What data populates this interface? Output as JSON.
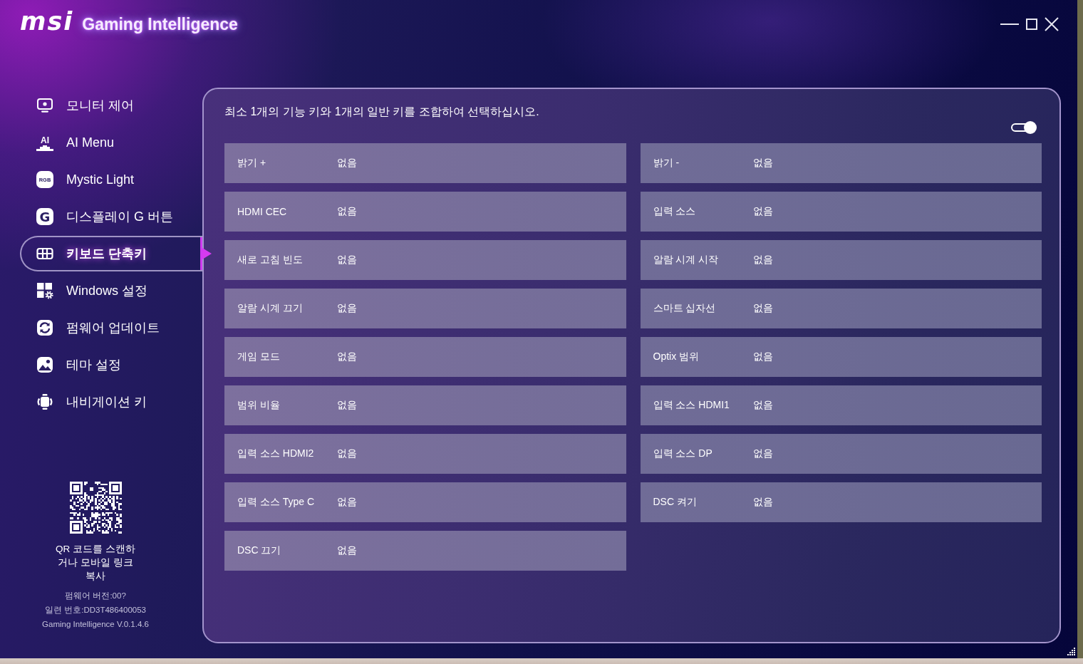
{
  "window": {
    "logo": "msi",
    "title": "Gaming Intelligence"
  },
  "sidebar": {
    "items": [
      {
        "label": "모니터 제어",
        "selected": false
      },
      {
        "label": "AI Menu",
        "icon_text": "AI",
        "selected": false
      },
      {
        "label": "Mystic Light",
        "icon_text": "RGB",
        "selected": false
      },
      {
        "label": "디스플레이 G 버튼",
        "icon_text": "G",
        "selected": false
      },
      {
        "label": "키보드 단축키",
        "selected": true
      },
      {
        "label": "Windows 설정",
        "selected": false
      },
      {
        "label": "펌웨어 업데이트",
        "selected": false
      },
      {
        "label": "테마 설정",
        "selected": false
      },
      {
        "label": "내비게이션 키",
        "selected": false
      }
    ],
    "qr_caption": "QR 코드를 스캔하거나 모바일 링크 복사",
    "firmware_version": "펌웨어 버전:00?",
    "serial_number": "일련 번호:DD3T486400053",
    "app_version": "Gaming Intelligence V.0.1.4.6"
  },
  "panel": {
    "instruction": "최소 1개의 기능 키와 1개의 일반 키를 조합하여 선택하십시오.",
    "toggle": {
      "on": true
    },
    "shortcuts": [
      {
        "label": "밝기 +",
        "value": "없음"
      },
      {
        "label": "밝기 -",
        "value": "없음"
      },
      {
        "label": "HDMI CEC",
        "value": "없음"
      },
      {
        "label": "입력 소스",
        "value": "없음"
      },
      {
        "label": "새로 고침 빈도",
        "value": "없음"
      },
      {
        "label": "알람 시계 시작",
        "value": "없음"
      },
      {
        "label": "알람 시계 끄기",
        "value": "없음"
      },
      {
        "label": "스마트 십자선",
        "value": "없음"
      },
      {
        "label": "게임 모드",
        "value": "없음"
      },
      {
        "label": "Optix 범위",
        "value": "없음"
      },
      {
        "label": "범위 비율",
        "value": "없음"
      },
      {
        "label": "입력 소스 HDMI1",
        "value": "없음"
      },
      {
        "label": "입력 소스 HDMI2",
        "value": "없음"
      },
      {
        "label": "입력 소스 DP",
        "value": "없음"
      },
      {
        "label": "입력 소스 Type C",
        "value": "없음"
      },
      {
        "label": "DSC 켜기",
        "value": "없음"
      },
      {
        "label": "DSC 끄기",
        "value": "없음"
      }
    ]
  }
}
